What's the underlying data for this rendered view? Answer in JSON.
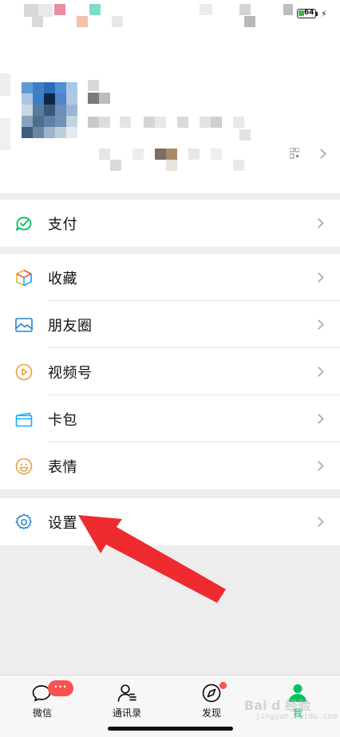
{
  "status_bar": {
    "battery_level": "64",
    "battery_icon": "battery-icon",
    "charging_icon": "bolt-icon"
  },
  "profile": {
    "qr_icon": "qr-code-icon",
    "chevron_icon": "chevron-right-icon"
  },
  "menu": {
    "pay": {
      "label": "支付",
      "icon": "pay-icon",
      "color": "#07c160"
    },
    "favorites": {
      "label": "收藏",
      "icon": "cube-icon"
    },
    "moments": {
      "label": "朋友圈",
      "icon": "image-icon",
      "color": "#2782d7"
    },
    "channels": {
      "label": "视频号",
      "icon": "play-circle-icon",
      "color": "#e6a23c"
    },
    "cards": {
      "label": "卡包",
      "icon": "card-icon",
      "color": "#10aeff"
    },
    "stickers": {
      "label": "表情",
      "icon": "smile-icon",
      "color": "#e6a23c"
    },
    "settings": {
      "label": "设置",
      "icon": "gear-icon",
      "color": "#2782d7"
    }
  },
  "tabs": [
    {
      "label": "微信",
      "icon": "chat-icon",
      "badge": "···"
    },
    {
      "label": "通讯录",
      "icon": "contacts-icon"
    },
    {
      "label": "发现",
      "icon": "compass-icon",
      "dot": true
    },
    {
      "label": "我",
      "icon": "person-icon",
      "active": true
    }
  ],
  "watermark": {
    "text": "Bai d 经验",
    "sub": "jingyan.baidu.com"
  },
  "colors": {
    "accent": "#07c160",
    "badge": "#fa5151",
    "annotation_arrow": "#ee2b2f"
  }
}
